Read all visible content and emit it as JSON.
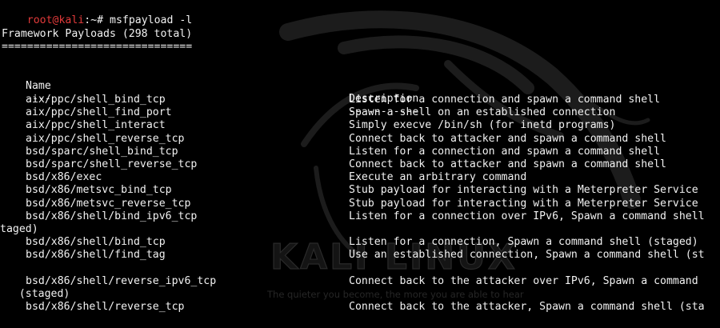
{
  "window": {
    "title": "root@kali:~# msfpayload -l"
  },
  "prompt": {
    "user_host": "root@kali",
    "path": ":~#",
    "command": "msfpayload -l"
  },
  "wallpaper": {
    "brand": "KALI LINUX",
    "tagline": "The quieter you become, the more you are able to hear"
  },
  "output": {
    "heading": "Framework Payloads (298 total)",
    "heading_rule": "==============================",
    "col_name_header": "Name",
    "col_desc_header": "Description",
    "col_name_rule": "----",
    "col_desc_rule": "-----------",
    "rows": [
      {
        "name": "aix/ppc/shell_bind_tcp",
        "desc": "Listen for a connection and spawn a command shell"
      },
      {
        "name": "aix/ppc/shell_find_port",
        "desc": "Spawn a shell on an established connection"
      },
      {
        "name": "aix/ppc/shell_interact",
        "desc": "Simply execve /bin/sh (for inetd programs)"
      },
      {
        "name": "aix/ppc/shell_reverse_tcp",
        "desc": "Connect back to attacker and spawn a command shell"
      },
      {
        "name": "bsd/sparc/shell_bind_tcp",
        "desc": "Listen for a connection and spawn a command shell"
      },
      {
        "name": "bsd/sparc/shell_reverse_tcp",
        "desc": "Connect back to attacker and spawn a command shell"
      },
      {
        "name": "bsd/x86/exec",
        "desc": "Execute an arbitrary command"
      },
      {
        "name": "bsd/x86/metsvc_bind_tcp",
        "desc": "Stub payload for interacting with a Meterpreter Service"
      },
      {
        "name": "bsd/x86/metsvc_reverse_tcp",
        "desc": "Stub payload for interacting with a Meterpreter Service"
      },
      {
        "name": "bsd/x86/shell/bind_ipv6_tcp",
        "desc": "Listen for a connection over IPv6, Spawn a command shell"
      },
      {
        "wrap": "taged)"
      },
      {
        "name": "bsd/x86/shell/bind_tcp",
        "desc": "Listen for a connection, Spawn a command shell (staged)"
      },
      {
        "name": "bsd/x86/shell/find_tag",
        "desc": "Use an established connection, Spawn a command shell (st"
      },
      {
        "blank": true
      },
      {
        "name": "bsd/x86/shell/reverse_ipv6_tcp",
        "desc": "Connect back to the attacker over IPv6, Spawn a command"
      },
      {
        "wrap": "   (staged)"
      },
      {
        "name": "bsd/x86/shell/reverse_tcp",
        "desc": "Connect back to the attacker, Spawn a command shell (sta"
      }
    ]
  }
}
